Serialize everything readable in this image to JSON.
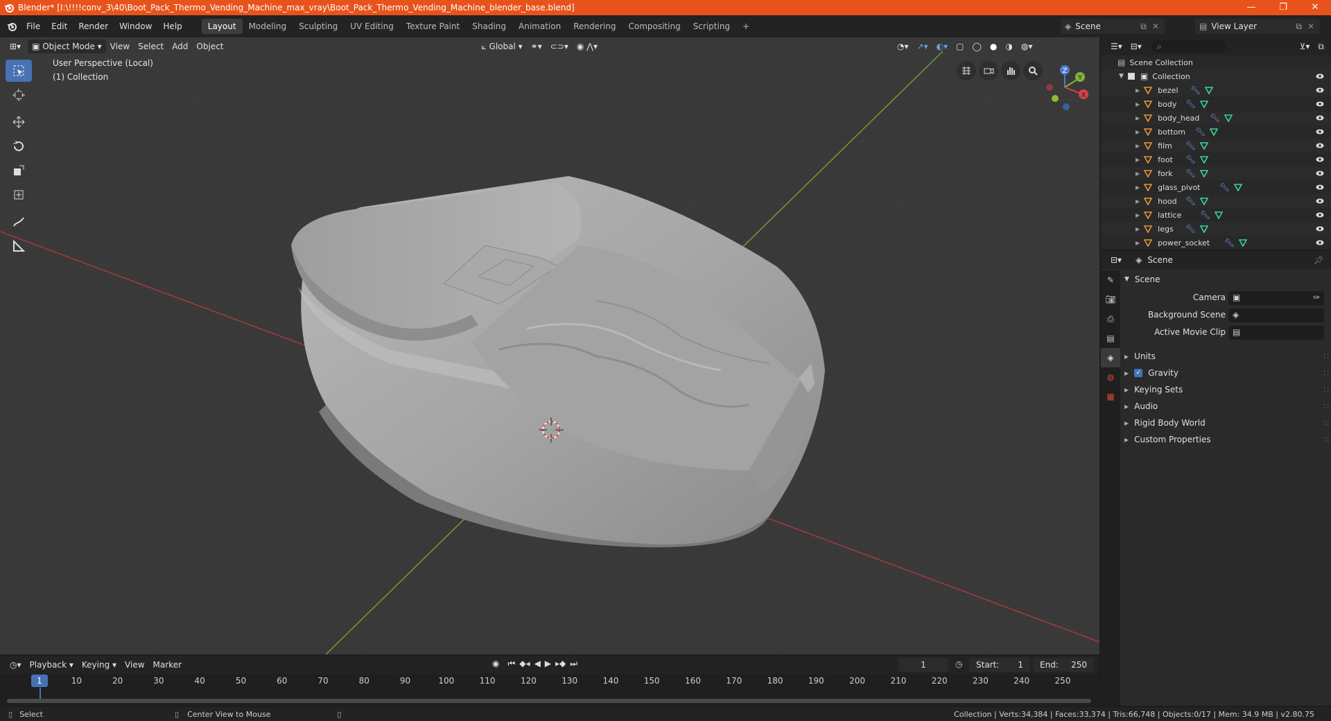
{
  "window": {
    "title": "Blender* [I:\\!!!!conv_3\\40\\Boot_Pack_Thermo_Vending_Machine_max_vray\\Boot_Pack_Thermo_Vending_Machine_blender_base.blend]",
    "minimize": "—",
    "restore": "❐",
    "close": "✕"
  },
  "menu": [
    "File",
    "Edit",
    "Render",
    "Window",
    "Help"
  ],
  "workspaces": [
    "Layout",
    "Modeling",
    "Sculpting",
    "UV Editing",
    "Texture Paint",
    "Shading",
    "Animation",
    "Rendering",
    "Compositing",
    "Scripting"
  ],
  "workspace_add": "+",
  "scene_selector": "Scene",
  "view_layer": "View Layer",
  "viewport": {
    "mode": "Object Mode",
    "menus": [
      "View",
      "Select",
      "Add",
      "Object"
    ],
    "transform_orientation": "Global",
    "overlay_title": "User Perspective (Local)",
    "overlay_collection": "(1) Collection",
    "gizmo_axes": {
      "x": "X",
      "y": "Y",
      "z": "Z"
    }
  },
  "outliner": {
    "root": "Scene Collection",
    "collection": "Collection",
    "objects": [
      "bezel",
      "body",
      "body_head",
      "bottom",
      "film",
      "foot",
      "fork",
      "glass_pivot",
      "hood",
      "lattice",
      "legs",
      "power_socket"
    ]
  },
  "properties": {
    "context": "Scene",
    "panel_title": "Scene",
    "fields": [
      {
        "label": "Camera"
      },
      {
        "label": "Background Scene"
      },
      {
        "label": "Active Movie Clip"
      }
    ],
    "subpanels": [
      {
        "label": "Units",
        "checkbox": false
      },
      {
        "label": "Gravity",
        "checkbox": true
      },
      {
        "label": "Keying Sets",
        "checkbox": false
      },
      {
        "label": "Audio",
        "checkbox": false
      },
      {
        "label": "Rigid Body World",
        "checkbox": false
      },
      {
        "label": "Custom Properties",
        "checkbox": false
      }
    ]
  },
  "timeline": {
    "menus": [
      "Playback",
      "Keying",
      "View",
      "Marker"
    ],
    "current_frame": "1",
    "start_label": "Start:",
    "start": "1",
    "end_label": "End:",
    "end": "250",
    "ticks": [
      "1",
      "10",
      "20",
      "30",
      "40",
      "50",
      "60",
      "70",
      "80",
      "90",
      "100",
      "110",
      "120",
      "130",
      "140",
      "150",
      "160",
      "170",
      "180",
      "190",
      "200",
      "210",
      "220",
      "230",
      "240",
      "250"
    ]
  },
  "statusbar": {
    "select": "Select",
    "center_view": "Center View to Mouse",
    "stats": "Collection | Verts:34,384 | Faces:33,374 | Tris:66,748 | Objects:0/17 | Mem: 34.9 MB | v2.80.75"
  },
  "colors": {
    "titlebar": "#e8531b",
    "accent": "#4772b3",
    "object_icon": "#e8953a",
    "modifier_icon": "#6a9fe8",
    "mesh_icon": "#3fd0a0"
  }
}
